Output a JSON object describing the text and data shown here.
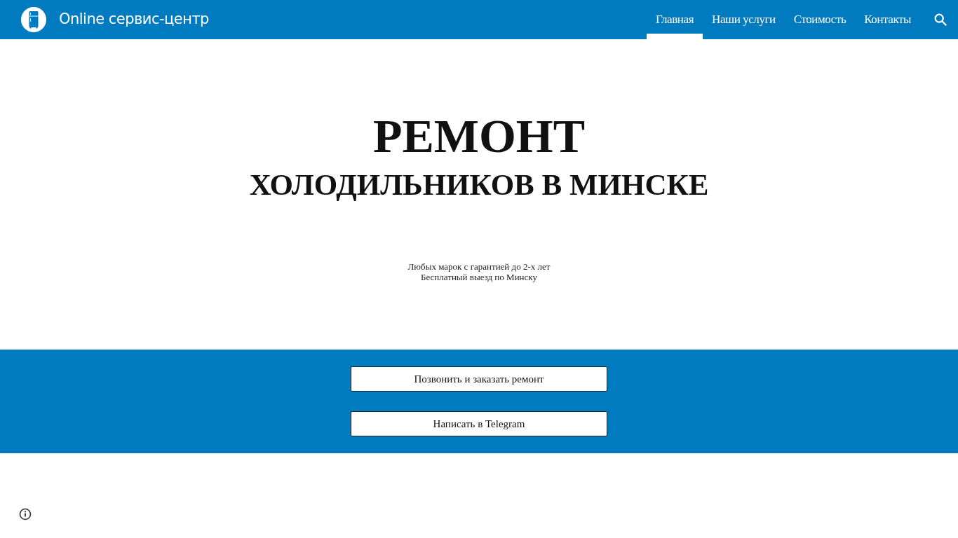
{
  "header": {
    "site_title": "Online сервис-центр",
    "nav": [
      {
        "label": "Главная",
        "selected": true
      },
      {
        "label": "Наши услуги",
        "selected": false
      },
      {
        "label": "Стоимость",
        "selected": false
      },
      {
        "label": "Контакты",
        "selected": false
      }
    ]
  },
  "hero": {
    "title": "РЕМОНТ",
    "subtitle": "ХОЛОДИЛЬНИКОВ В МИНСКЕ",
    "lines": [
      "Любых марок с гарантией до 2-х лет",
      "Бесплатный выезд по Минску"
    ]
  },
  "actions": [
    "Позвонить и заказать ремонт",
    "Написать в Telegram"
  ]
}
